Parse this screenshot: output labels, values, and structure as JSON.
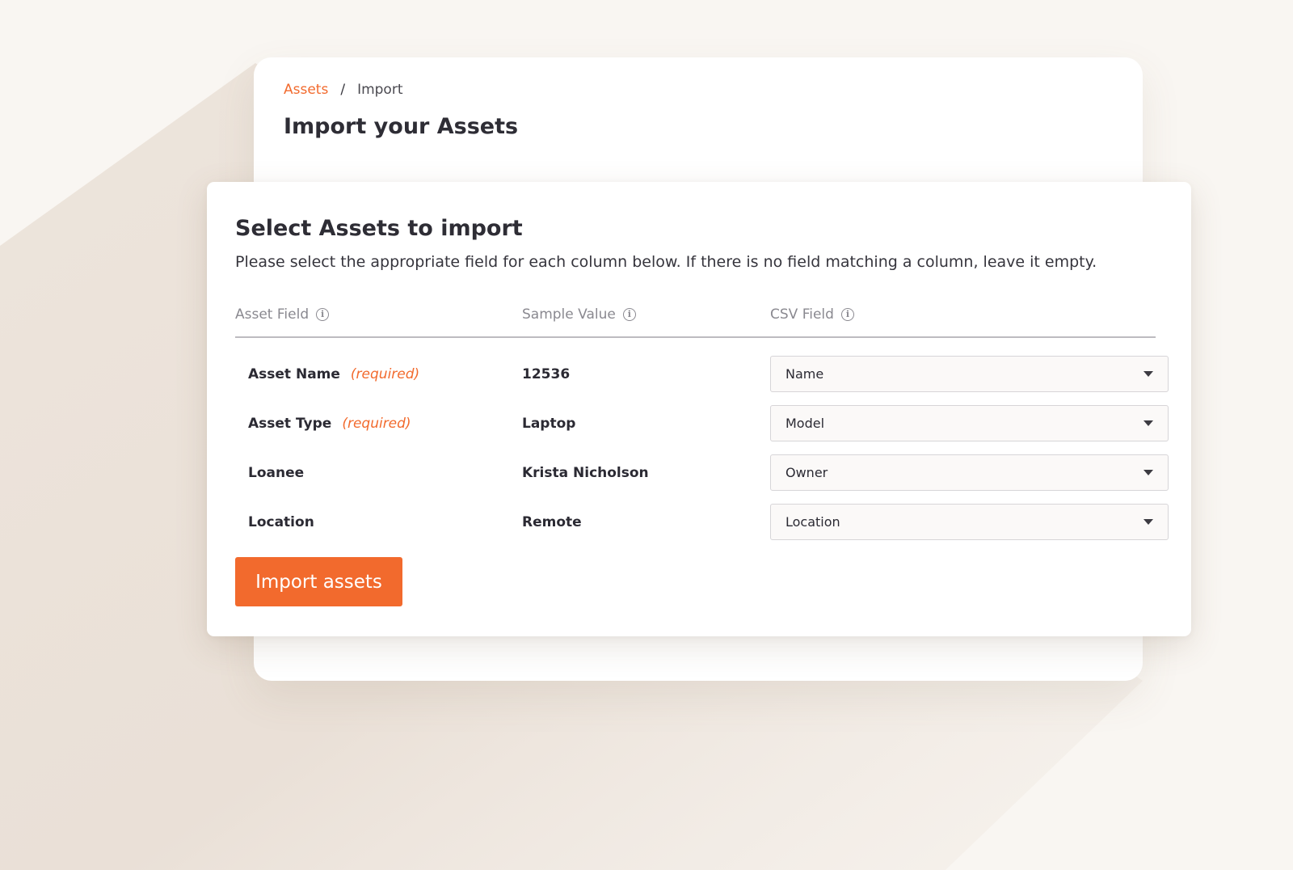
{
  "breadcrumb": {
    "parent": "Assets",
    "separator": "/",
    "current": "Import"
  },
  "page_title": "Import your Assets",
  "modal": {
    "title": "Select Assets to import",
    "description": "Please select the appropriate field for each column below. If there is no field matching a column, leave it empty.",
    "columns": {
      "asset_field": "Asset Field",
      "sample_value": "Sample Value",
      "csv_field": "CSV Field"
    },
    "rows": [
      {
        "field": "Asset Name",
        "required": "(required)",
        "sample": "12536",
        "csv": "Name"
      },
      {
        "field": "Asset Type",
        "required": "(required)",
        "sample": "Laptop",
        "csv": "Model"
      },
      {
        "field": "Loanee",
        "required": "",
        "sample": "Krista Nicholson",
        "csv": "Owner"
      },
      {
        "field": "Location",
        "required": "",
        "sample": "Remote",
        "csv": "Location"
      }
    ],
    "import_button": "Import assets"
  },
  "colors": {
    "accent": "#f26a2d",
    "background": "#f9f6f2",
    "text": "#2b2a33",
    "muted": "#8a8990"
  },
  "icons": {
    "info": "info-icon",
    "dropdown": "chevron-down-icon"
  }
}
